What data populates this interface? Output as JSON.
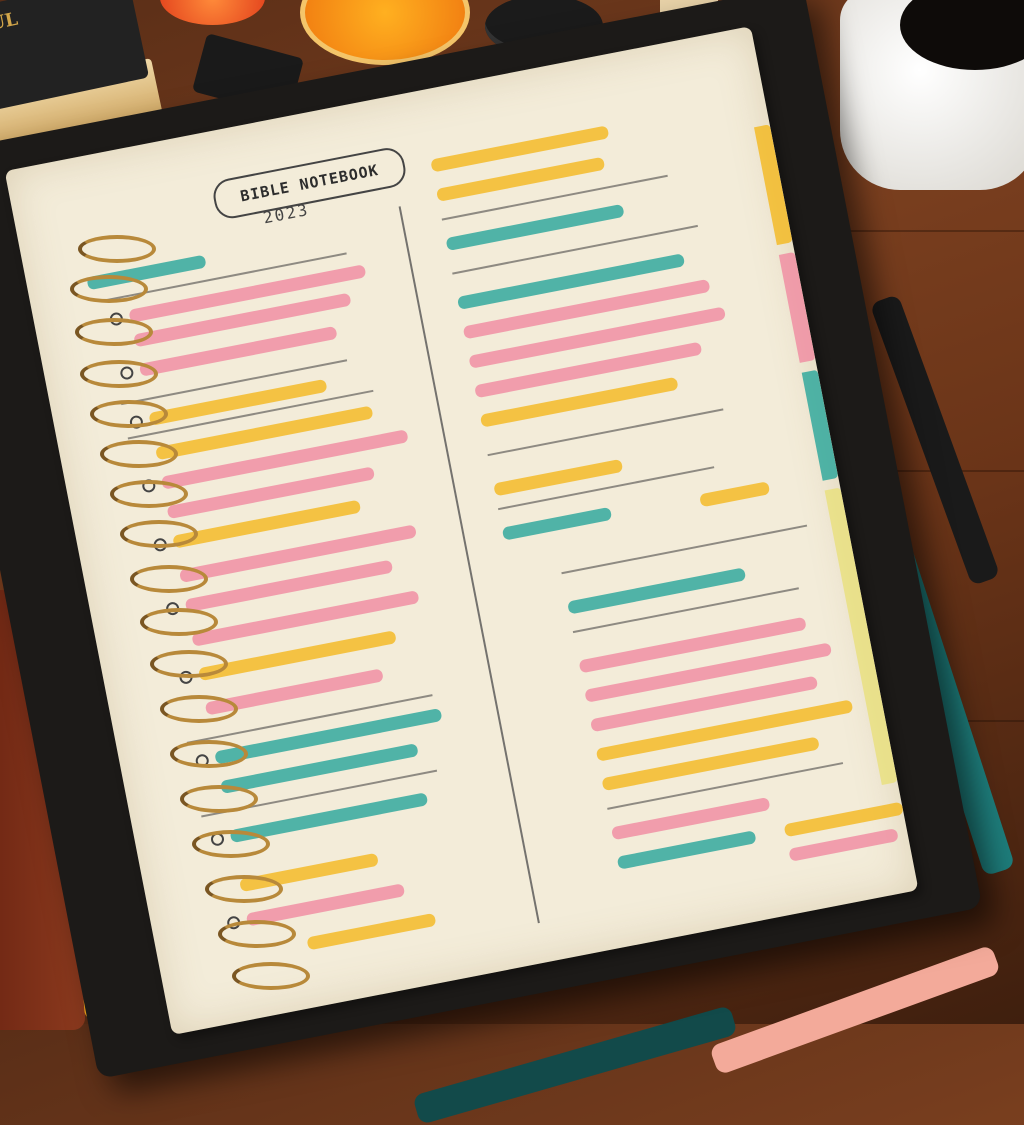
{
  "scene": "desk",
  "notebook": {
    "title": "BIBLE NOTEBOOK",
    "year": "2023",
    "highlight_colors": [
      "#f4b81d",
      "#f08aa0",
      "#27a59a",
      "#e9e07a"
    ]
  },
  "objects": {
    "bible_cover_text": "SUL",
    "mug_color": "#ffffff",
    "pens": [
      "pink-pen",
      "black-pen",
      "teal-pen",
      "yellow-pen",
      "dark-teal-fountain-pen",
      "pink-pen-bottom"
    ]
  }
}
